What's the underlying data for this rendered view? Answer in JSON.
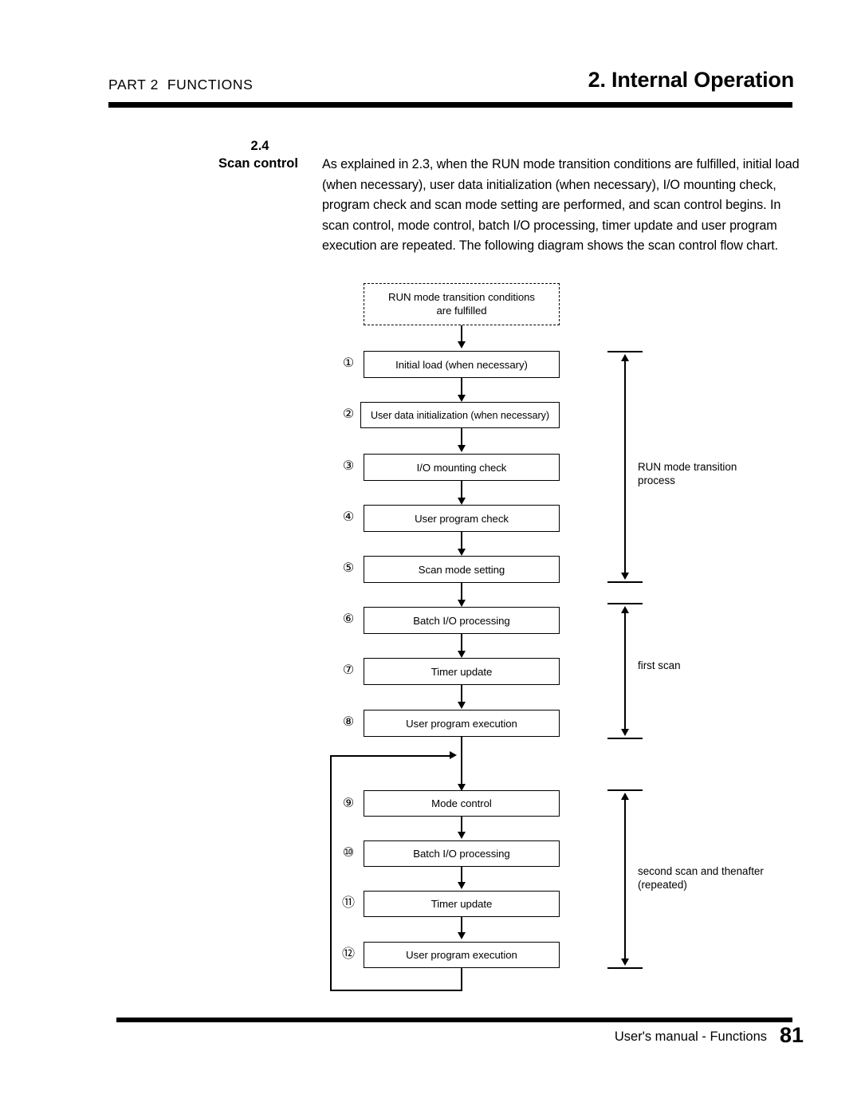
{
  "header": {
    "part_label": "PART 2  FUNCTIONS",
    "chapter_title": "2. Internal Operation"
  },
  "section": {
    "number": "2.4",
    "title": "Scan control",
    "body": "As explained in 2.3, when the RUN mode transition conditions are fulfilled, initial load (when necessary), user data initialization (when necessary), I/O mounting check, program check and scan mode setting are performed, and scan control begins.  In scan control, mode control, batch I/O processing, timer update and user program execution are repeated.  The following diagram shows the scan control flow chart."
  },
  "flowchart": {
    "start_box": {
      "line1": "RUN mode transition conditions",
      "line2": "are fulfilled"
    },
    "steps": [
      {
        "num": "①",
        "label": "Initial load (when necessary)"
      },
      {
        "num": "②",
        "label": "User data initialization (when necessary)"
      },
      {
        "num": "③",
        "label": "I/O mounting check"
      },
      {
        "num": "④",
        "label": "User program check"
      },
      {
        "num": "⑤",
        "label": "Scan mode setting"
      },
      {
        "num": "⑥",
        "label": "Batch I/O processing"
      },
      {
        "num": "⑦",
        "label": "Timer update"
      },
      {
        "num": "⑧",
        "label": "User program execution"
      },
      {
        "num": "⑨",
        "label": "Mode control"
      },
      {
        "num": "⑩",
        "label": "Batch I/O processing"
      },
      {
        "num": "⑪",
        "label": "Timer update"
      },
      {
        "num": "⑫",
        "label": "User program execution"
      }
    ],
    "annotations": [
      {
        "label": "RUN mode transition\nprocess"
      },
      {
        "label": "first scan"
      },
      {
        "label": "second scan and thenafter\n(repeated)"
      }
    ]
  },
  "footer": {
    "text": "User's manual - Functions",
    "page": "81"
  }
}
